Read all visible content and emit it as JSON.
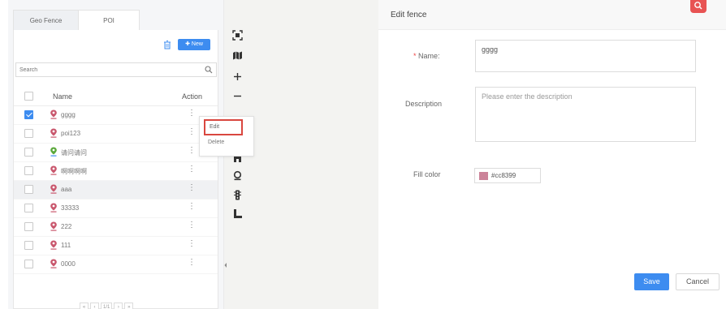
{
  "tabs": [
    {
      "label": "Geo Fence"
    },
    {
      "label": "POI"
    }
  ],
  "toolbar": {
    "new_label": "New"
  },
  "search": {
    "placeholder": "Search"
  },
  "table": {
    "headers": {
      "name": "Name",
      "action": "Action"
    },
    "rows": [
      {
        "name": "gggg",
        "checked": true
      },
      {
        "name": "poi123",
        "checked": false
      },
      {
        "name": "请问请问",
        "checked": false
      },
      {
        "name": "啊啊啊啊",
        "checked": false
      },
      {
        "name": "aaa",
        "checked": false
      },
      {
        "name": "33333",
        "checked": false
      },
      {
        "name": "222",
        "checked": false
      },
      {
        "name": "111",
        "checked": false
      },
      {
        "name": "0000",
        "checked": false
      }
    ],
    "action_glyph": "⋮"
  },
  "pagination": {
    "first": "«",
    "prev": "‹",
    "page": "1/1",
    "next": "›",
    "last": "»"
  },
  "context_menu": {
    "edit": "Edit",
    "delete": "Delete"
  },
  "map_tools": [
    "fullscreen-icon",
    "map-layer-icon",
    "zoom-in-icon",
    "zoom-out-icon",
    "polygon-icon",
    "poi-pin-icon",
    "traffic-light-icon",
    "measure-icon"
  ],
  "edit_fence": {
    "title": "Edit fence",
    "name_label": "Name:",
    "required_mark": "*",
    "name_value": "gggg",
    "description_label": "Description",
    "description_placeholder": "Please enter the description",
    "fill_color_label": "Fill color",
    "fill_color_value": "#cc8399",
    "save_label": "Save",
    "cancel_label": "Cancel"
  },
  "colors": {
    "accent": "#3d8cf0",
    "pin": "#c9576d",
    "highlight": "#d9473f"
  }
}
